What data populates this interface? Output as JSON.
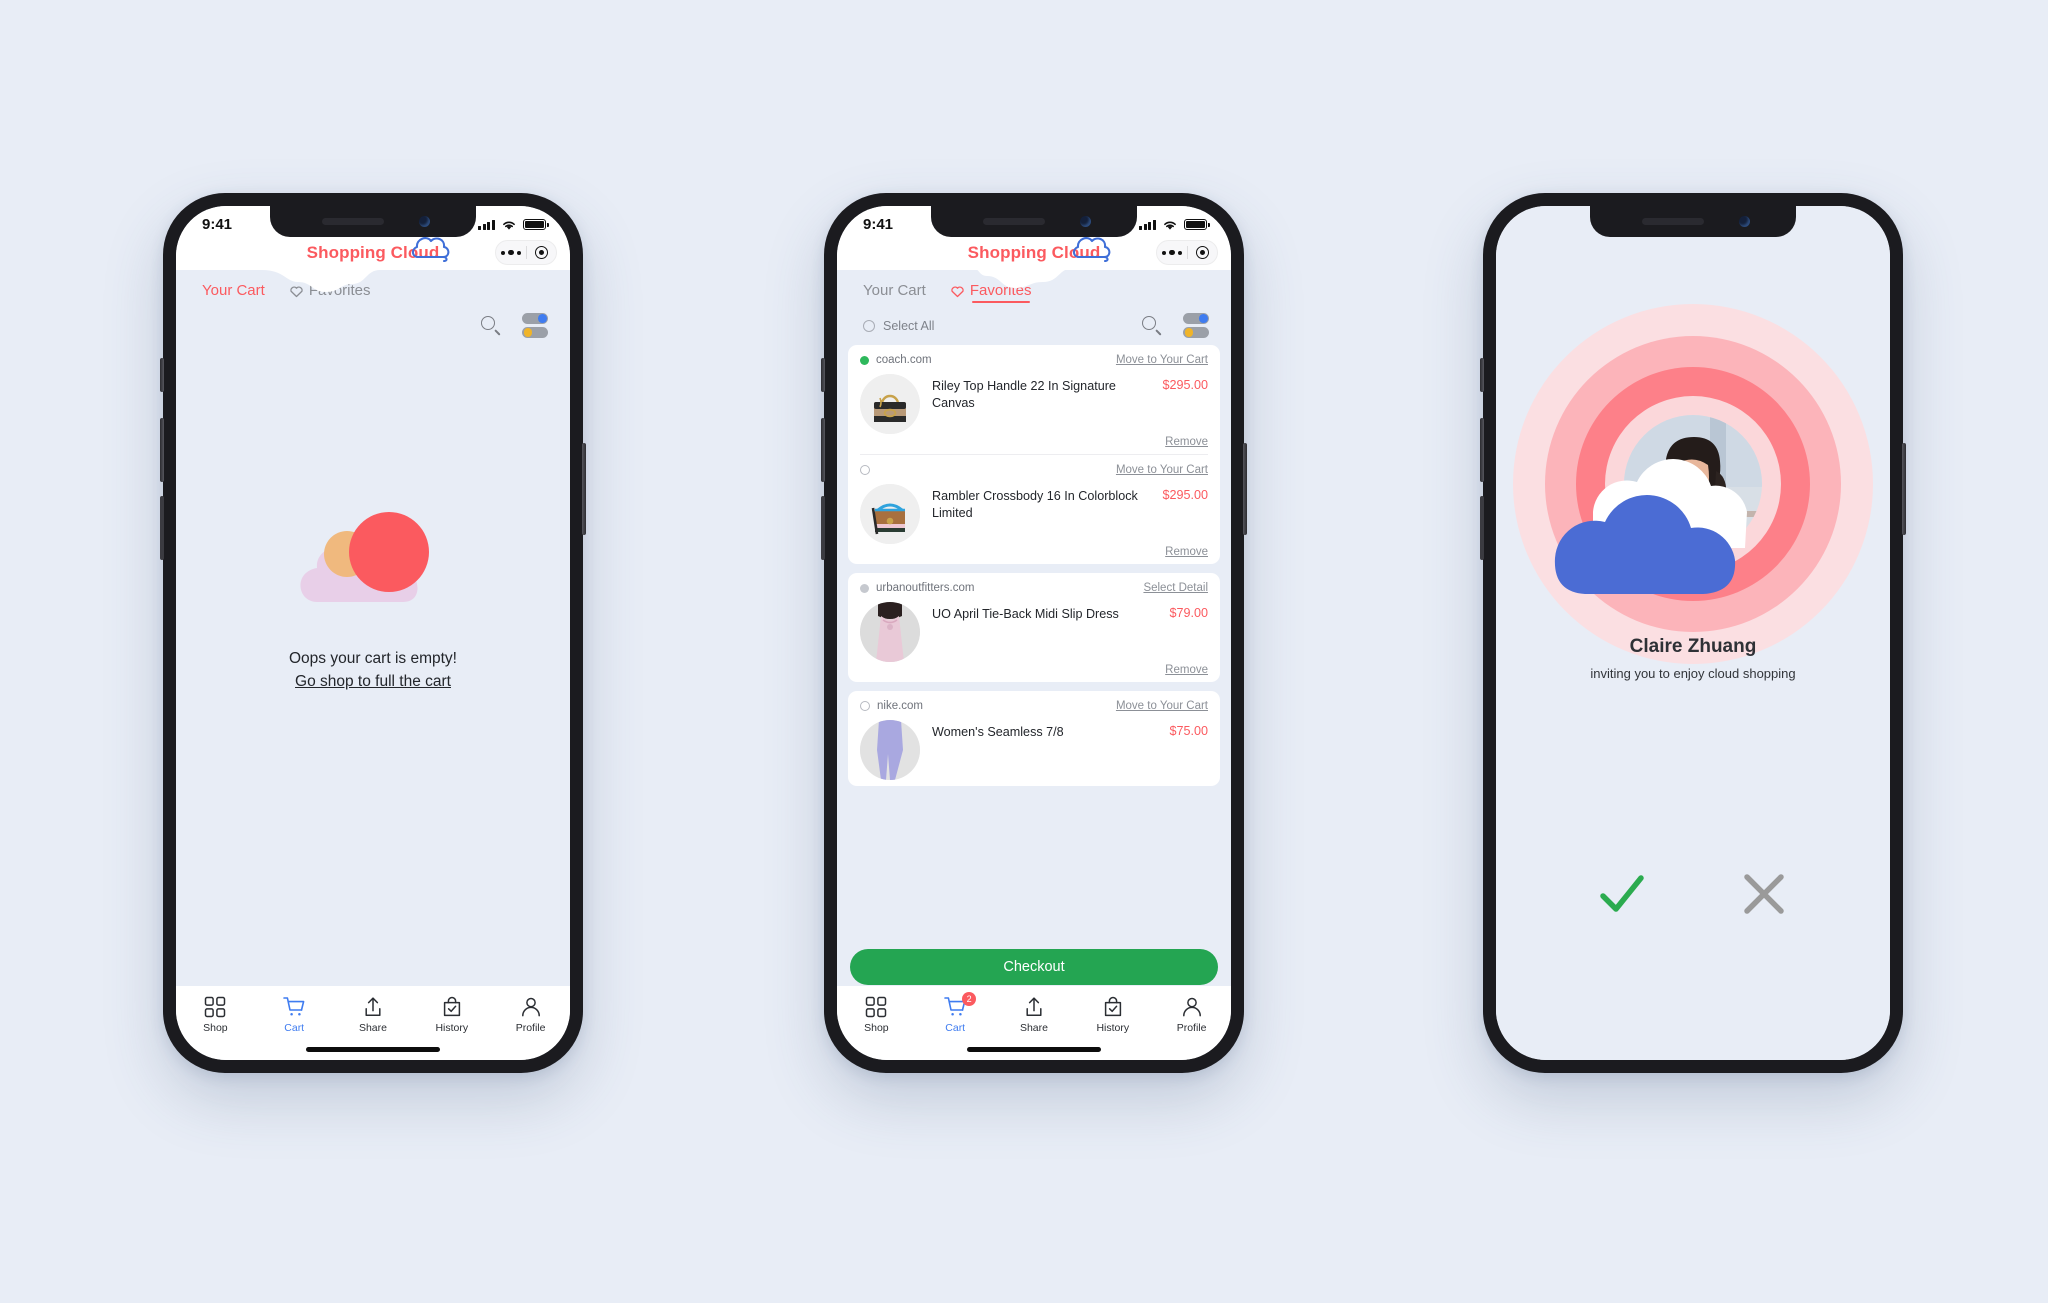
{
  "background_color": "#e8edf6",
  "brand": {
    "name": "Shopping Cloud",
    "accent_color": "#fb5a5f",
    "cloud_color": "#3f6fd8"
  },
  "status_bar": {
    "time": "9:41"
  },
  "header_capsule": {
    "more_icon": "more-dots-icon",
    "target_icon": "target-circle-icon"
  },
  "tabs": {
    "your_cart": "Your Cart",
    "favorites": "Favorites",
    "favorites_icon": "heart-icon"
  },
  "toolbar": {
    "select_all": "Select All",
    "search_icon": "search-icon",
    "filter_icon": "filter-toggles-icon",
    "toggle_on_color": "#3f7cf0",
    "toggle_off_color": "#f0b429"
  },
  "empty_state": {
    "line1": "Oops your cart is empty!",
    "line2": "Go shop to full the cart",
    "art_colors": {
      "red": "#fb5a5f",
      "orange": "#f0b97e",
      "lilac": "#e8cfe8"
    }
  },
  "groups": [
    {
      "site": "coach.com",
      "marker": "filled-green",
      "action": "Move to Your Cart",
      "items": [
        {
          "name": "Riley Top Handle 22 In Signature Canvas",
          "price": "$295.00",
          "remove": "Remove",
          "thumb": "handbag-signature-canvas"
        }
      ]
    },
    {
      "site": "",
      "marker": "hollow",
      "action": "Move to Your Cart",
      "items": [
        {
          "name": "Rambler Crossbody 16 In Colorblock Limited",
          "price": "$295.00",
          "remove": "Remove",
          "thumb": "crossbody-colorblock"
        }
      ]
    },
    {
      "site": "urbanoutfitters.com",
      "marker": "filled-grey",
      "action": "Select Detail",
      "items": [
        {
          "name": "UO April Tie-Back Midi Slip Dress",
          "price": "$79.00",
          "remove": "Remove",
          "thumb": "pink-slip-dress"
        }
      ]
    },
    {
      "site": "nike.com",
      "marker": "hollow",
      "action": "Move to Your Cart",
      "items": [
        {
          "name": "Women's Seamless 7/8",
          "price": "$75.00",
          "remove": "",
          "thumb": "lavender-leggings"
        }
      ]
    }
  ],
  "checkout": {
    "label": "Checkout",
    "color": "#24a552"
  },
  "tabbar": {
    "items": [
      {
        "label": "Shop",
        "icon": "grid-icon",
        "active": false,
        "badge": ""
      },
      {
        "label": "Cart",
        "icon": "cart-icon",
        "active": true,
        "badge": "2"
      },
      {
        "label": "Share",
        "icon": "share-icon",
        "active": false,
        "badge": ""
      },
      {
        "label": "History",
        "icon": "bag-check-icon",
        "active": false,
        "badge": ""
      },
      {
        "label": "Profile",
        "icon": "person-icon",
        "active": false,
        "badge": ""
      }
    ],
    "active_color": "#3f7cf0"
  },
  "invite": {
    "name": "Claire Zhuang",
    "subtitle": "inviting you to enjoy cloud shopping",
    "accept_icon": "check-icon",
    "decline_icon": "close-icon",
    "accept_color": "#2bab4f",
    "decline_color": "#9a9a9a",
    "ring_colors": [
      "#fbdfe2",
      "#fcb4ba",
      "#fd8089",
      "#fbd7da"
    ]
  }
}
